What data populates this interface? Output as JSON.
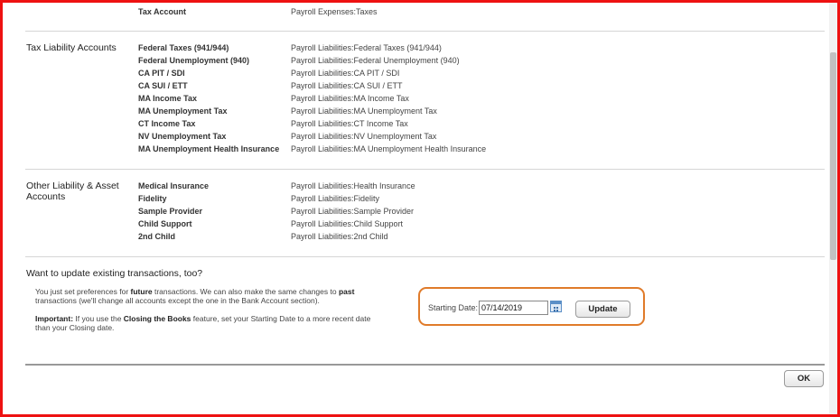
{
  "top_row": {
    "label": "Tax Account",
    "value": "Payroll Expenses:Taxes"
  },
  "tax_liability": {
    "title": "Tax Liability Accounts",
    "rows": [
      {
        "label": "Federal Taxes (941/944)",
        "value": "Payroll Liabilities:Federal Taxes (941/944)"
      },
      {
        "label": "Federal Unemployment (940)",
        "value": "Payroll Liabilities:Federal Unemployment (940)"
      },
      {
        "label": "CA PIT / SDI",
        "value": "Payroll Liabilities:CA PIT / SDI"
      },
      {
        "label": "CA SUI / ETT",
        "value": "Payroll Liabilities:CA SUI / ETT"
      },
      {
        "label": "MA Income Tax",
        "value": "Payroll Liabilities:MA Income Tax"
      },
      {
        "label": "MA Unemployment Tax",
        "value": "Payroll Liabilities:MA Unemployment Tax"
      },
      {
        "label": "CT Income Tax",
        "value": "Payroll Liabilities:CT Income Tax"
      },
      {
        "label": "NV Unemployment Tax",
        "value": "Payroll Liabilities:NV Unemployment Tax"
      },
      {
        "label": "MA Unemployment Health Insurance",
        "value": "Payroll Liabilities:MA Unemployment Health Insurance"
      }
    ]
  },
  "other_liability": {
    "title": "Other Liability & Asset Accounts",
    "rows": [
      {
        "label": "Medical Insurance",
        "value": "Payroll Liabilities:Health Insurance"
      },
      {
        "label": "Fidelity",
        "value": "Payroll Liabilities:Fidelity"
      },
      {
        "label": "Sample Provider",
        "value": "Payroll Liabilities:Sample Provider"
      },
      {
        "label": "Child Support",
        "value": "Payroll Liabilities:Child Support"
      },
      {
        "label": "2nd Child",
        "value": "Payroll Liabilities:2nd Child"
      }
    ]
  },
  "update_section": {
    "title": "Want to update existing transactions, too?",
    "info1_a": "You just set preferences for ",
    "info1_b": "future",
    "info1_c": " transactions. We can also make the same changes to ",
    "info1_d": "past",
    "info1_e": " transactions (we'll change all accounts except the one in the Bank Account section).",
    "info2_a": "Important:",
    "info2_b": " If you use the ",
    "info2_c": "Closing the Books",
    "info2_d": " feature, set your Starting Date to a more recent date than your Closing date.",
    "starting_date_label": "Starting Date:",
    "starting_date_value": "07/14/2019",
    "update_label": "Update"
  },
  "footer": {
    "ok_label": "OK"
  },
  "colors": {
    "frame": "#ee1111",
    "highlight": "#e07b2a"
  },
  "icons": {
    "date_picker": "calendar-icon"
  }
}
